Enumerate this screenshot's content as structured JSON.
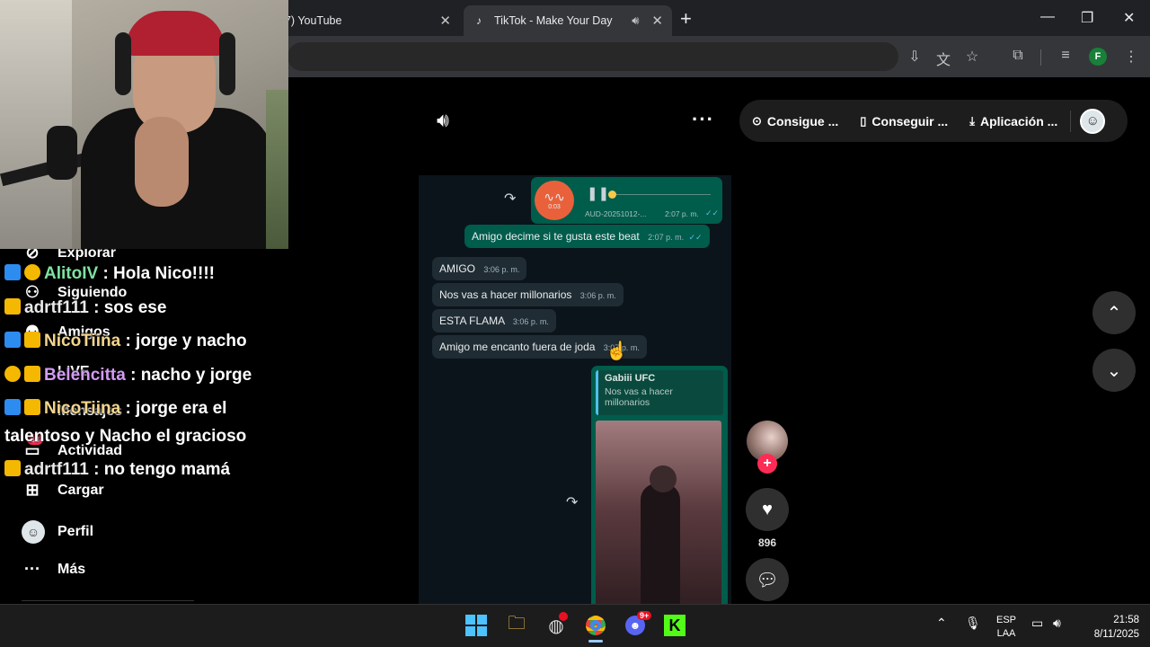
{
  "browser": {
    "tabs": [
      {
        "label": "17) YouTube"
      },
      {
        "label": "TikTok - Make Your Day"
      }
    ],
    "new_tab": "+",
    "window": {
      "minimize": "—",
      "maximize": "❐",
      "close": "✕"
    },
    "profile_initial": "F"
  },
  "tiktok": {
    "topbar": {
      "coins_label": "Consigue ...",
      "app_label": "Conseguir ...",
      "download_label": "Aplicación ..."
    },
    "sidebar": {
      "items": [
        {
          "label": "Explorar"
        },
        {
          "label": "Siguiendo"
        },
        {
          "label": "Amigos"
        },
        {
          "label": "LIVE"
        },
        {
          "label": "Mensajes"
        },
        {
          "label": "Actividad"
        },
        {
          "label": "Cargar"
        },
        {
          "label": "Perfil"
        },
        {
          "label": "Más"
        }
      ],
      "activity_badge": "33"
    },
    "video": {
      "voice_note": {
        "file": "AUD-20251012-...",
        "time": "2:07 p. m.",
        "duration": "0:03"
      },
      "messages": [
        {
          "text": "Amigo decime si te gusta este beat",
          "time": "2:07 p. m.",
          "dir": "out"
        },
        {
          "text": "AMIGO",
          "time": "3:06 p. m.",
          "dir": "in"
        },
        {
          "text": "Nos vas a hacer millonarios",
          "time": "3:06 p. m.",
          "dir": "in"
        },
        {
          "text": "ESTA FLAMA",
          "time": "3:06 p. m.",
          "dir": "in"
        },
        {
          "text": "Amigo me encanto fuera de joda",
          "time": "3:07 p. m.",
          "dir": "in"
        }
      ],
      "reply": {
        "author": "Gabiii UFC",
        "quote_line1": "Nos vas a hacer",
        "quote_line2": "millonarios"
      }
    },
    "actions": {
      "likes": "896"
    }
  },
  "chat": [
    {
      "user": "AlitoIV",
      "message": " : Hola Nico!!!!",
      "color": "#7fe3a0"
    },
    {
      "user": "adrtf111",
      "message": " : sos ese",
      "color": "#e9e9e9"
    },
    {
      "user": "NicoTiina",
      "message": " : jorge y nacho",
      "color": "#f4d58d"
    },
    {
      "user": "Belencitta",
      "message": " : nacho y jorge",
      "color": "#d39bf5"
    },
    {
      "user": "NicoTiina",
      "message": " : jorge era el",
      "color": "#f4d58d"
    },
    {
      "user": "",
      "message": "talentoso y Nacho el gracioso",
      "color": "#ffffff"
    },
    {
      "user": "adrtf111",
      "message": " : no tengo mamá",
      "color": "#e9e9e9"
    }
  ],
  "taskbar": {
    "language": "ESP",
    "layout": "LAA",
    "time": "21:58",
    "date": "8/11/2025",
    "discord_badge": "9+"
  }
}
